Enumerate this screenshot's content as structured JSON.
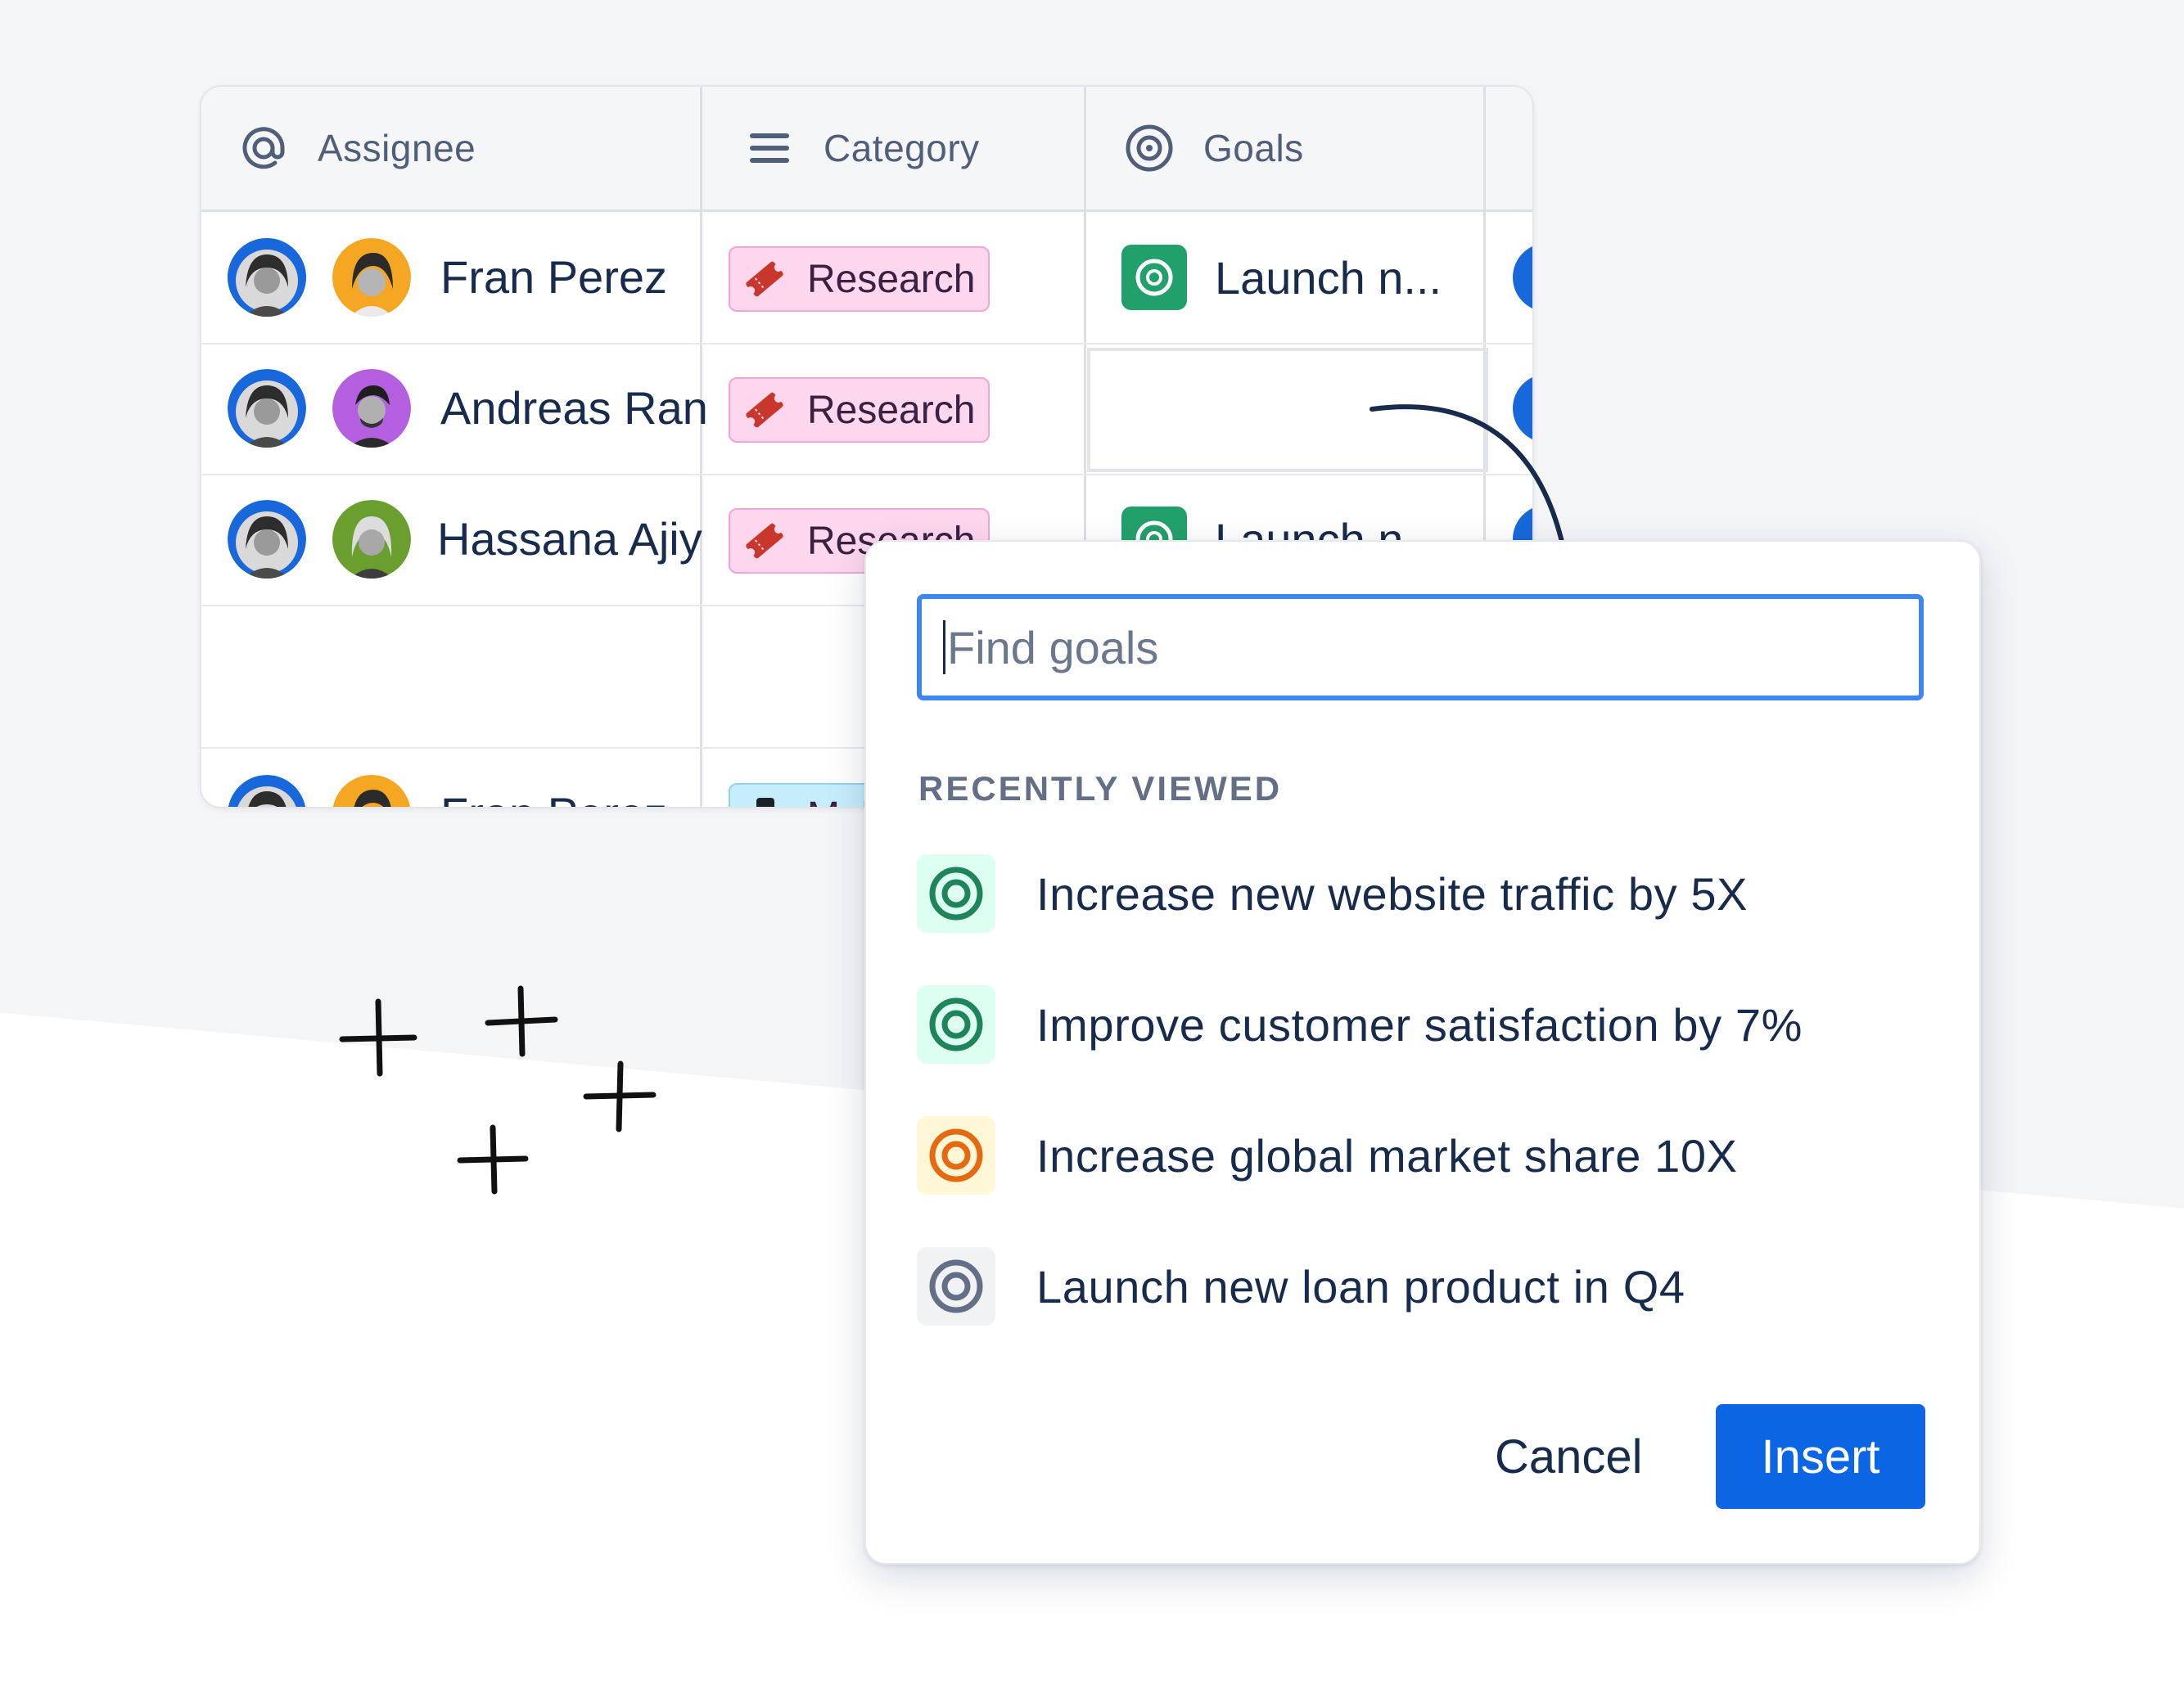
{
  "table": {
    "headers": [
      {
        "label": "Assignee",
        "icon": "at-icon"
      },
      {
        "label": "Category",
        "icon": "menu-lines-icon"
      },
      {
        "label": "Goals",
        "icon": "target-icon"
      }
    ],
    "rows": [
      {
        "name": "Fran Perez",
        "category": "Research",
        "goal": "Launch n...",
        "avatar_color": "#f5a623"
      },
      {
        "name": "Andreas Ran",
        "category": "Research",
        "goal": "",
        "avatar_color": "#b45ee0"
      },
      {
        "name": "Hassana Ajiy",
        "category": "Research",
        "goal": "Launch n...",
        "avatar_color": "#6a9e2e"
      },
      {
        "name": "Fran Perez",
        "category": "Mol",
        "goal": "",
        "avatar_color": "#f5a623"
      }
    ]
  },
  "popup": {
    "search_placeholder": "Find goals",
    "section_label": "RECENTLY VIEWED",
    "items": [
      {
        "text": "Increase new website traffic by 5X",
        "icon": "target-icon",
        "color": "#1f845a",
        "bg": "#dcfff1"
      },
      {
        "text": "Improve customer satisfaction by 7%",
        "icon": "target-icon",
        "color": "#1f845a",
        "bg": "#dcfff1"
      },
      {
        "text": "Increase global market share 10X",
        "icon": "target-icon",
        "color": "#e56910",
        "bg": "#fff7d6"
      },
      {
        "text": "Launch new loan product in Q4",
        "icon": "target-icon",
        "color": "#626f86",
        "bg": "#f1f2f4"
      }
    ],
    "cancel_label": "Cancel",
    "insert_label": "Insert"
  },
  "colors": {
    "accent": "#0c66e4",
    "focus": "#3e86f0",
    "category_tag": "#fcd7ee",
    "goal_green": "#22a06b"
  }
}
